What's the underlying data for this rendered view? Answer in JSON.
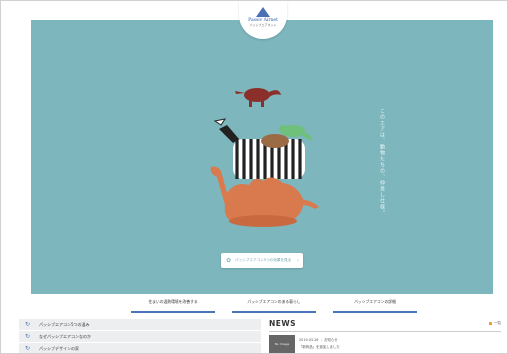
{
  "logo": {
    "brand": "Passiv Airnet",
    "sub": "パッシブエアネット"
  },
  "hero": {
    "tagline": "このエアは、動物たちの、仲良し仕様。",
    "cta_label": "パッシブエアコン5つの効果を見る"
  },
  "tabs": [
    {
      "label": "住まいの温熱環境を改善する"
    },
    {
      "label": "パッシブエアコンのある暮らし"
    },
    {
      "label": "パッシブエアコンの詳細"
    }
  ],
  "sidebar": {
    "items": [
      {
        "label": "パッシブエアコン5つの温み"
      },
      {
        "label": "なぜパッシブエアコンなのか"
      },
      {
        "label": "パッシブデザインの家"
      }
    ]
  },
  "news": {
    "title": "NEWS",
    "more_label": "一覧",
    "items": [
      {
        "thumb": "No Image",
        "date": "2019.03.26 ｜ お知らせ",
        "text": "「新商品」を追加しました"
      }
    ]
  },
  "colors": {
    "hero_bg": "#7db6bd",
    "accent": "#4a74b8",
    "news_badge": "#e8a23a"
  }
}
